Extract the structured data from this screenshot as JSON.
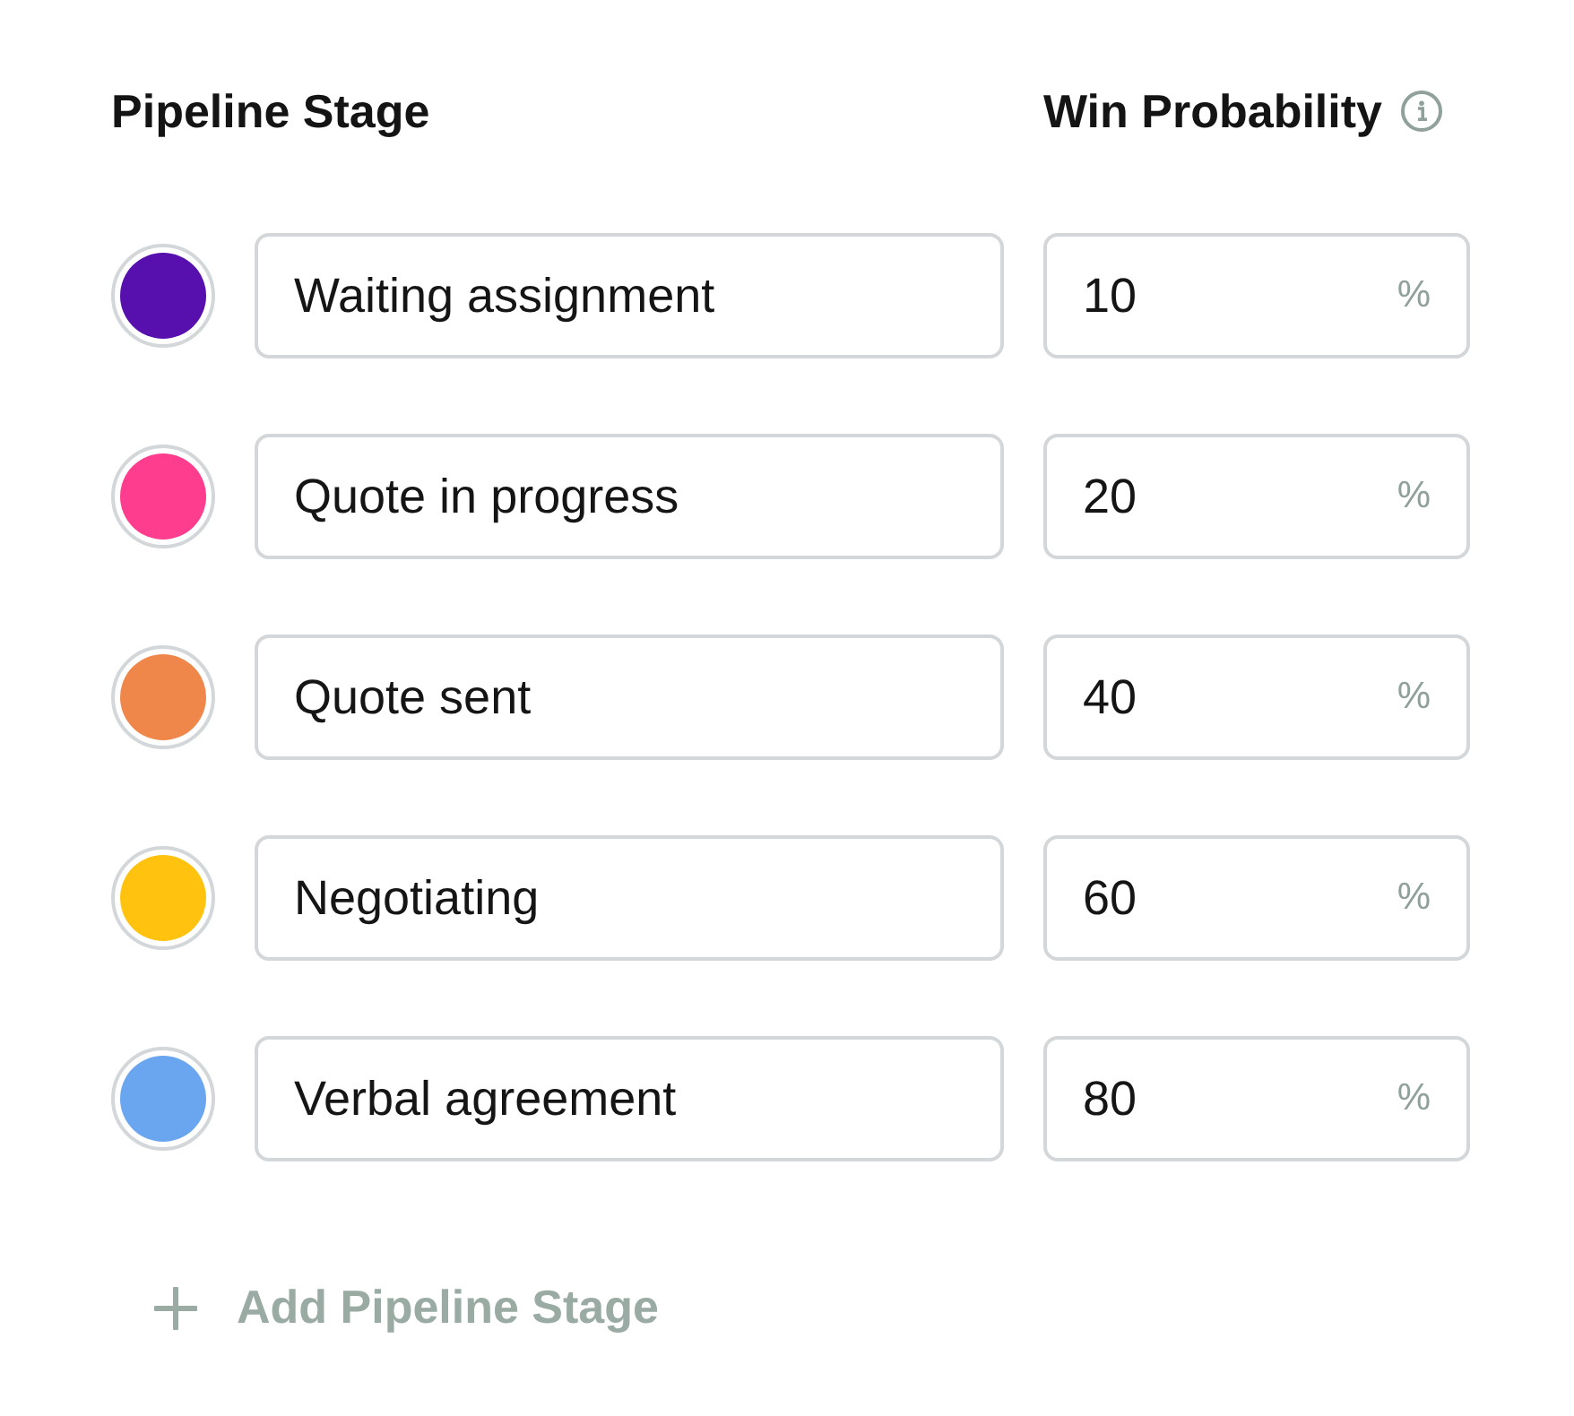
{
  "headers": {
    "stage": "Pipeline Stage",
    "probability": "Win Probability"
  },
  "stages": [
    {
      "color": "#5710ae",
      "name": "Waiting assignment",
      "probability": "10",
      "unit": "%"
    },
    {
      "color": "#ff3d8f",
      "name": "Quote in progress",
      "probability": "20",
      "unit": "%"
    },
    {
      "color": "#ef874b",
      "name": "Quote sent",
      "probability": "40",
      "unit": "%"
    },
    {
      "color": "#ffc20e",
      "name": "Negotiating",
      "probability": "60",
      "unit": "%"
    },
    {
      "color": "#6aa5f0",
      "name": "Verbal agreement",
      "probability": "80",
      "unit": "%"
    }
  ],
  "add_button": {
    "label": "Add Pipeline Stage"
  }
}
